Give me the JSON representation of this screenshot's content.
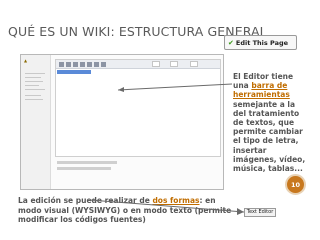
{
  "slide": {
    "title": "QUÉ ES UN WIKI: ESTRUCTURA GENERAL",
    "page_number": "10"
  },
  "edit_badge": {
    "label": "Edit This Page",
    "icon": "check-icon"
  },
  "callout": {
    "part1": "El Editor tiene una",
    "highlight": "barra de herramientas",
    "part2": "semejante a la del tratamiento de textos, que permite cambiar el tipo de letra, insertar imágenes, vídeo, música, tablas..."
  },
  "bottom_note": {
    "part1": "La edición se puede realizar de",
    "highlight": "dos formas",
    "part2": ": en modo visual (WYSIWYG) o en modo texto (permite modificar los códigos fuentes)"
  },
  "textedit_button": {
    "label": "Text Editor"
  },
  "colors": {
    "accent": "#c06d00",
    "badge_circle": "#c8781e",
    "text": "#555555"
  }
}
